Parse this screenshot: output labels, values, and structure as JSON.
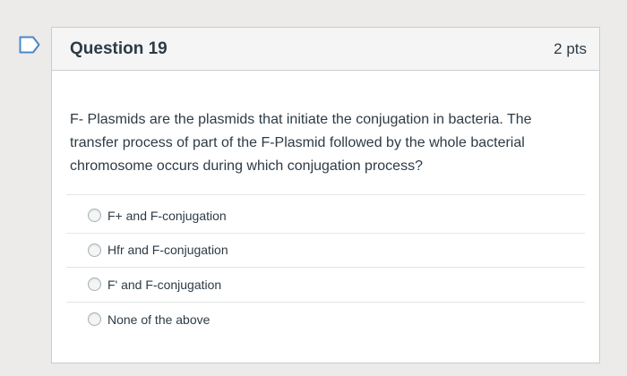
{
  "question": {
    "title": "Question 19",
    "points": "2 pts",
    "text": "F- Plasmids are the plasmids that initiate the conjugation in bacteria. The transfer process of part of the F-Plasmid followed by the whole bacterial chromosome occurs during which conjugation process?",
    "flag_icon": "bookmark-flag-icon",
    "answers": [
      {
        "label": "F+ and F-conjugation",
        "selected": false
      },
      {
        "label": "Hfr and F-conjugation",
        "selected": false
      },
      {
        "label": "F' and F-conjugation",
        "selected": false
      },
      {
        "label": "None of the above",
        "selected": false
      }
    ]
  },
  "colors": {
    "accent": "#2d3b45",
    "flag": "#4a88c7",
    "background": "#ecebea"
  }
}
